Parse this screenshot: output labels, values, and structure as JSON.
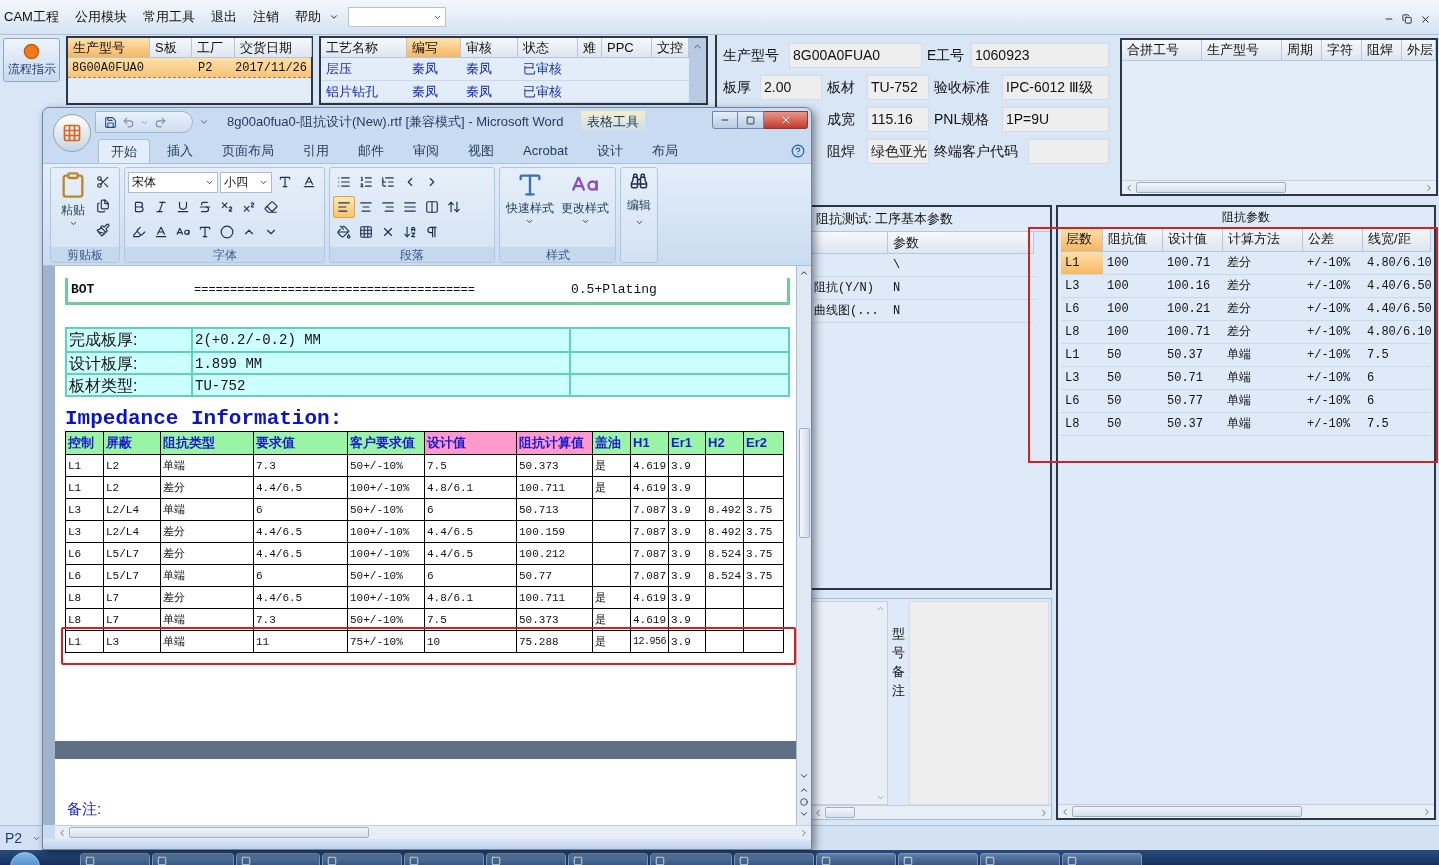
{
  "menu": {
    "items": [
      "CAM工程",
      "公用模块",
      "常用工具",
      "退出",
      "注销",
      "帮助"
    ]
  },
  "flow_button": {
    "label": "流程指示"
  },
  "order_grid": {
    "columns": [
      {
        "label": "生产型号",
        "sorted": true
      },
      {
        "label": "S板",
        "sorted": false
      },
      {
        "label": "工厂",
        "sorted": false
      },
      {
        "label": "交货日期",
        "sorted": false
      }
    ],
    "rows": [
      {
        "selected": true,
        "model": "8G00A0FUA0",
        "factory": "P2",
        "delivery_date": "2017/11/26"
      }
    ]
  },
  "process_grid": {
    "columns": [
      {
        "label": "工艺名称",
        "sorted": false
      },
      {
        "label": "编写",
        "sorted": true
      },
      {
        "label": "审核",
        "sorted": false
      },
      {
        "label": "状态",
        "sorted": false
      },
      {
        "label": "难",
        "sorted": false
      },
      {
        "label": "PPC",
        "sorted": false
      },
      {
        "label": "文控",
        "sorted": false
      }
    ],
    "rows": [
      {
        "name": "层压",
        "writer": "秦凤",
        "reviewer": "秦凤",
        "status": "已审核"
      },
      {
        "name": "铝片钻孔",
        "writer": "秦凤",
        "reviewer": "秦凤",
        "status": "已审核"
      }
    ]
  },
  "info": {
    "model": {
      "label": "生产型号",
      "value": "8G00A0FUA0"
    },
    "e_number": {
      "label": "E工号",
      "value": "1060923"
    },
    "thickness": {
      "label": "板厚",
      "value": "2.00"
    },
    "material": {
      "label": "板材",
      "value": "TU-752"
    },
    "standard": {
      "label": "验收标准",
      "value": "IPC-6012 Ⅲ级"
    },
    "finished_width": {
      "label": "成宽",
      "value": "115.16"
    },
    "pnl_spec": {
      "label": "PNL规格",
      "value": "1P=9U"
    },
    "solder_mask": {
      "label": "阻焊",
      "value": "绿色亚光"
    },
    "end_customer_code": {
      "label": "终端客户代码"
    }
  },
  "merge_grid": {
    "columns": [
      "合拼工号",
      "生产型号",
      "周期",
      "字符",
      "阻焊",
      "外层"
    ]
  },
  "test_panel": {
    "title": "阻抗测试: 工序基本参数",
    "columns": [
      {},
      {
        "label": "参数"
      }
    ],
    "rows": [
      {
        "value": "\\"
      },
      {
        "item": "阻抗(Y/N)",
        "value": "N"
      },
      {
        "item": "曲线图(...",
        "value": "N"
      }
    ]
  },
  "remarks": {
    "label": "型号备注"
  },
  "impedance_params": {
    "title": "阻抗参数",
    "marked": true,
    "columns": [
      "层数",
      "阻抗值",
      "设计值",
      "计算方法",
      "公差",
      "线宽/距"
    ],
    "rows": [
      {
        "selected": true,
        "cells": [
          "L1",
          "100",
          "100.71",
          "差分",
          "+/-10%",
          "4.80/6.10"
        ]
      },
      {
        "selected": false,
        "cells": [
          "L3",
          "100",
          "100.16",
          "差分",
          "+/-10%",
          "4.40/6.50"
        ]
      },
      {
        "selected": false,
        "cells": [
          "L6",
          "100",
          "100.21",
          "差分",
          "+/-10%",
          "4.40/6.50"
        ]
      },
      {
        "selected": false,
        "cells": [
          "L8",
          "100",
          "100.71",
          "差分",
          "+/-10%",
          "4.80/6.10"
        ]
      },
      {
        "selected": false,
        "cells": [
          "L1",
          "50",
          "50.37",
          "单端",
          "+/-10%",
          "7.5"
        ]
      },
      {
        "selected": false,
        "cells": [
          "L3",
          "50",
          "50.71",
          "单端",
          "+/-10%",
          "6"
        ]
      },
      {
        "selected": false,
        "cells": [
          "L6",
          "50",
          "50.77",
          "单端",
          "+/-10%",
          "6"
        ]
      },
      {
        "selected": false,
        "cells": [
          "L8",
          "50",
          "50.37",
          "单端",
          "+/-10%",
          "7.5"
        ]
      }
    ]
  },
  "status_combo": {
    "value": "P2"
  },
  "word": {
    "title": "8g00a0fua0-阻抗设计(New).rtf [兼容模式] - Microsoft Word",
    "context_tab": "表格工具",
    "tabs": [
      {
        "label": "开始",
        "selected": true
      },
      {
        "label": "插入",
        "selected": false
      },
      {
        "label": "页面布局",
        "selected": false
      },
      {
        "label": "引用",
        "selected": false
      },
      {
        "label": "邮件",
        "selected": false
      },
      {
        "label": "审阅",
        "selected": false
      },
      {
        "label": "视图",
        "selected": false
      },
      {
        "label": "Acrobat",
        "selected": false
      },
      {
        "label": "设计",
        "selected": false
      },
      {
        "label": "布局",
        "selected": false
      }
    ],
    "ribbon": {
      "font_name": "宋体",
      "font_size": "小四",
      "align_buttons": [
        {
          "selected": true
        },
        {
          "selected": false
        },
        {
          "selected": false
        },
        {
          "selected": false
        },
        {
          "selected": false
        }
      ],
      "paste": "粘贴",
      "quick_styles": "快速样式",
      "change_styles": "更改样式",
      "editing": "编辑",
      "groups": [
        "剪贴板",
        "字体",
        "段落",
        "样式"
      ]
    },
    "document": {
      "stack_row": {
        "layer": "BOT",
        "line": "=======================================",
        "thickness": "0.5+Plating"
      },
      "board_table": [
        {
          "label": "完成板厚:",
          "value": "2(+0.2/-0.2) MM"
        },
        {
          "label": "设计板厚:",
          "value": "1.899 MM"
        },
        {
          "label": "板材类型:",
          "value": "TU-752"
        }
      ],
      "heading": "Impedance Information:",
      "impedance_columns": [
        {
          "label": "控制",
          "color": "#99f5a5"
        },
        {
          "label": "屏蔽",
          "color": "#99f5a5"
        },
        {
          "label": "阻抗类型",
          "color": "#99f5a5"
        },
        {
          "label": "要求值",
          "color": "#99f5a5"
        },
        {
          "label": "客户要求值",
          "color": "#99f5a5"
        },
        {
          "label": "设计值",
          "color": "#ff99cc"
        },
        {
          "label": "阻抗计算值",
          "color": "#ff99cc"
        },
        {
          "label": "盖油",
          "color": "#99f5a5"
        },
        {
          "label": "H1",
          "color": "#99f5a5"
        },
        {
          "label": "Er1",
          "color": "#99f5a5"
        },
        {
          "label": "H2",
          "color": "#99f5a5"
        },
        {
          "label": "Er2",
          "color": "#99f5a5"
        }
      ],
      "impedance_rows": [
        {
          "marked": false,
          "control": "L1",
          "shield": "L2",
          "type": "单端",
          "required": "7.3",
          "customer": "50+/-10%",
          "design": "7.5",
          "calc": "50.373",
          "oil": "是",
          "h1": "4.619",
          "er1": "3.9"
        },
        {
          "marked": false,
          "control": "L1",
          "shield": "L2",
          "type": "差分",
          "required": "4.4/6.5",
          "customer": "100+/-10%",
          "design": "4.8/6.1",
          "calc": "100.711",
          "oil": "是",
          "h1": "4.619",
          "er1": "3.9"
        },
        {
          "marked": false,
          "control": "L3",
          "shield": "L2/L4",
          "type": "单端",
          "required": "6",
          "customer": "50+/-10%",
          "design": "6",
          "calc": "50.713",
          "h1": "7.087",
          "er1": "3.9",
          "h2": "8.492",
          "er2": "3.75"
        },
        {
          "marked": false,
          "control": "L3",
          "shield": "L2/L4",
          "type": "差分",
          "required": "4.4/6.5",
          "customer": "100+/-10%",
          "design": "4.4/6.5",
          "calc": "100.159",
          "h1": "7.087",
          "er1": "3.9",
          "h2": "8.492",
          "er2": "3.75"
        },
        {
          "marked": false,
          "control": "L6",
          "shield": "L5/L7",
          "type": "差分",
          "required": "4.4/6.5",
          "customer": "100+/-10%",
          "design": "4.4/6.5",
          "calc": "100.212",
          "h1": "7.087",
          "er1": "3.9",
          "h2": "8.524",
          "er2": "3.75"
        },
        {
          "marked": false,
          "control": "L6",
          "shield": "L5/L7",
          "type": "单端",
          "required": "6",
          "customer": "50+/-10%",
          "design": "6",
          "calc": "50.77",
          "h1": "7.087",
          "er1": "3.9",
          "h2": "8.524",
          "er2": "3.75"
        },
        {
          "marked": false,
          "control": "L8",
          "shield": "L7",
          "type": "差分",
          "required": "4.4/6.5",
          "customer": "100+/-10%",
          "design": "4.8/6.1",
          "calc": "100.711",
          "oil": "是",
          "h1": "4.619",
          "er1": "3.9"
        },
        {
          "marked": false,
          "control": "L8",
          "shield": "L7",
          "type": "单端",
          "required": "7.3",
          "customer": "50+/-10%",
          "design": "7.5",
          "calc": "50.373",
          "oil": "是",
          "h1": "4.619",
          "er1": "3.9"
        },
        {
          "marked": true,
          "control": "L1",
          "shield": "L3",
          "type": "单端",
          "required": "11",
          "customer": "75+/-10%",
          "design": "10",
          "calc": "75.288",
          "oil": "是",
          "h1": "12.956",
          "er1": "3.9"
        }
      ],
      "note_label": "备注:"
    }
  }
}
